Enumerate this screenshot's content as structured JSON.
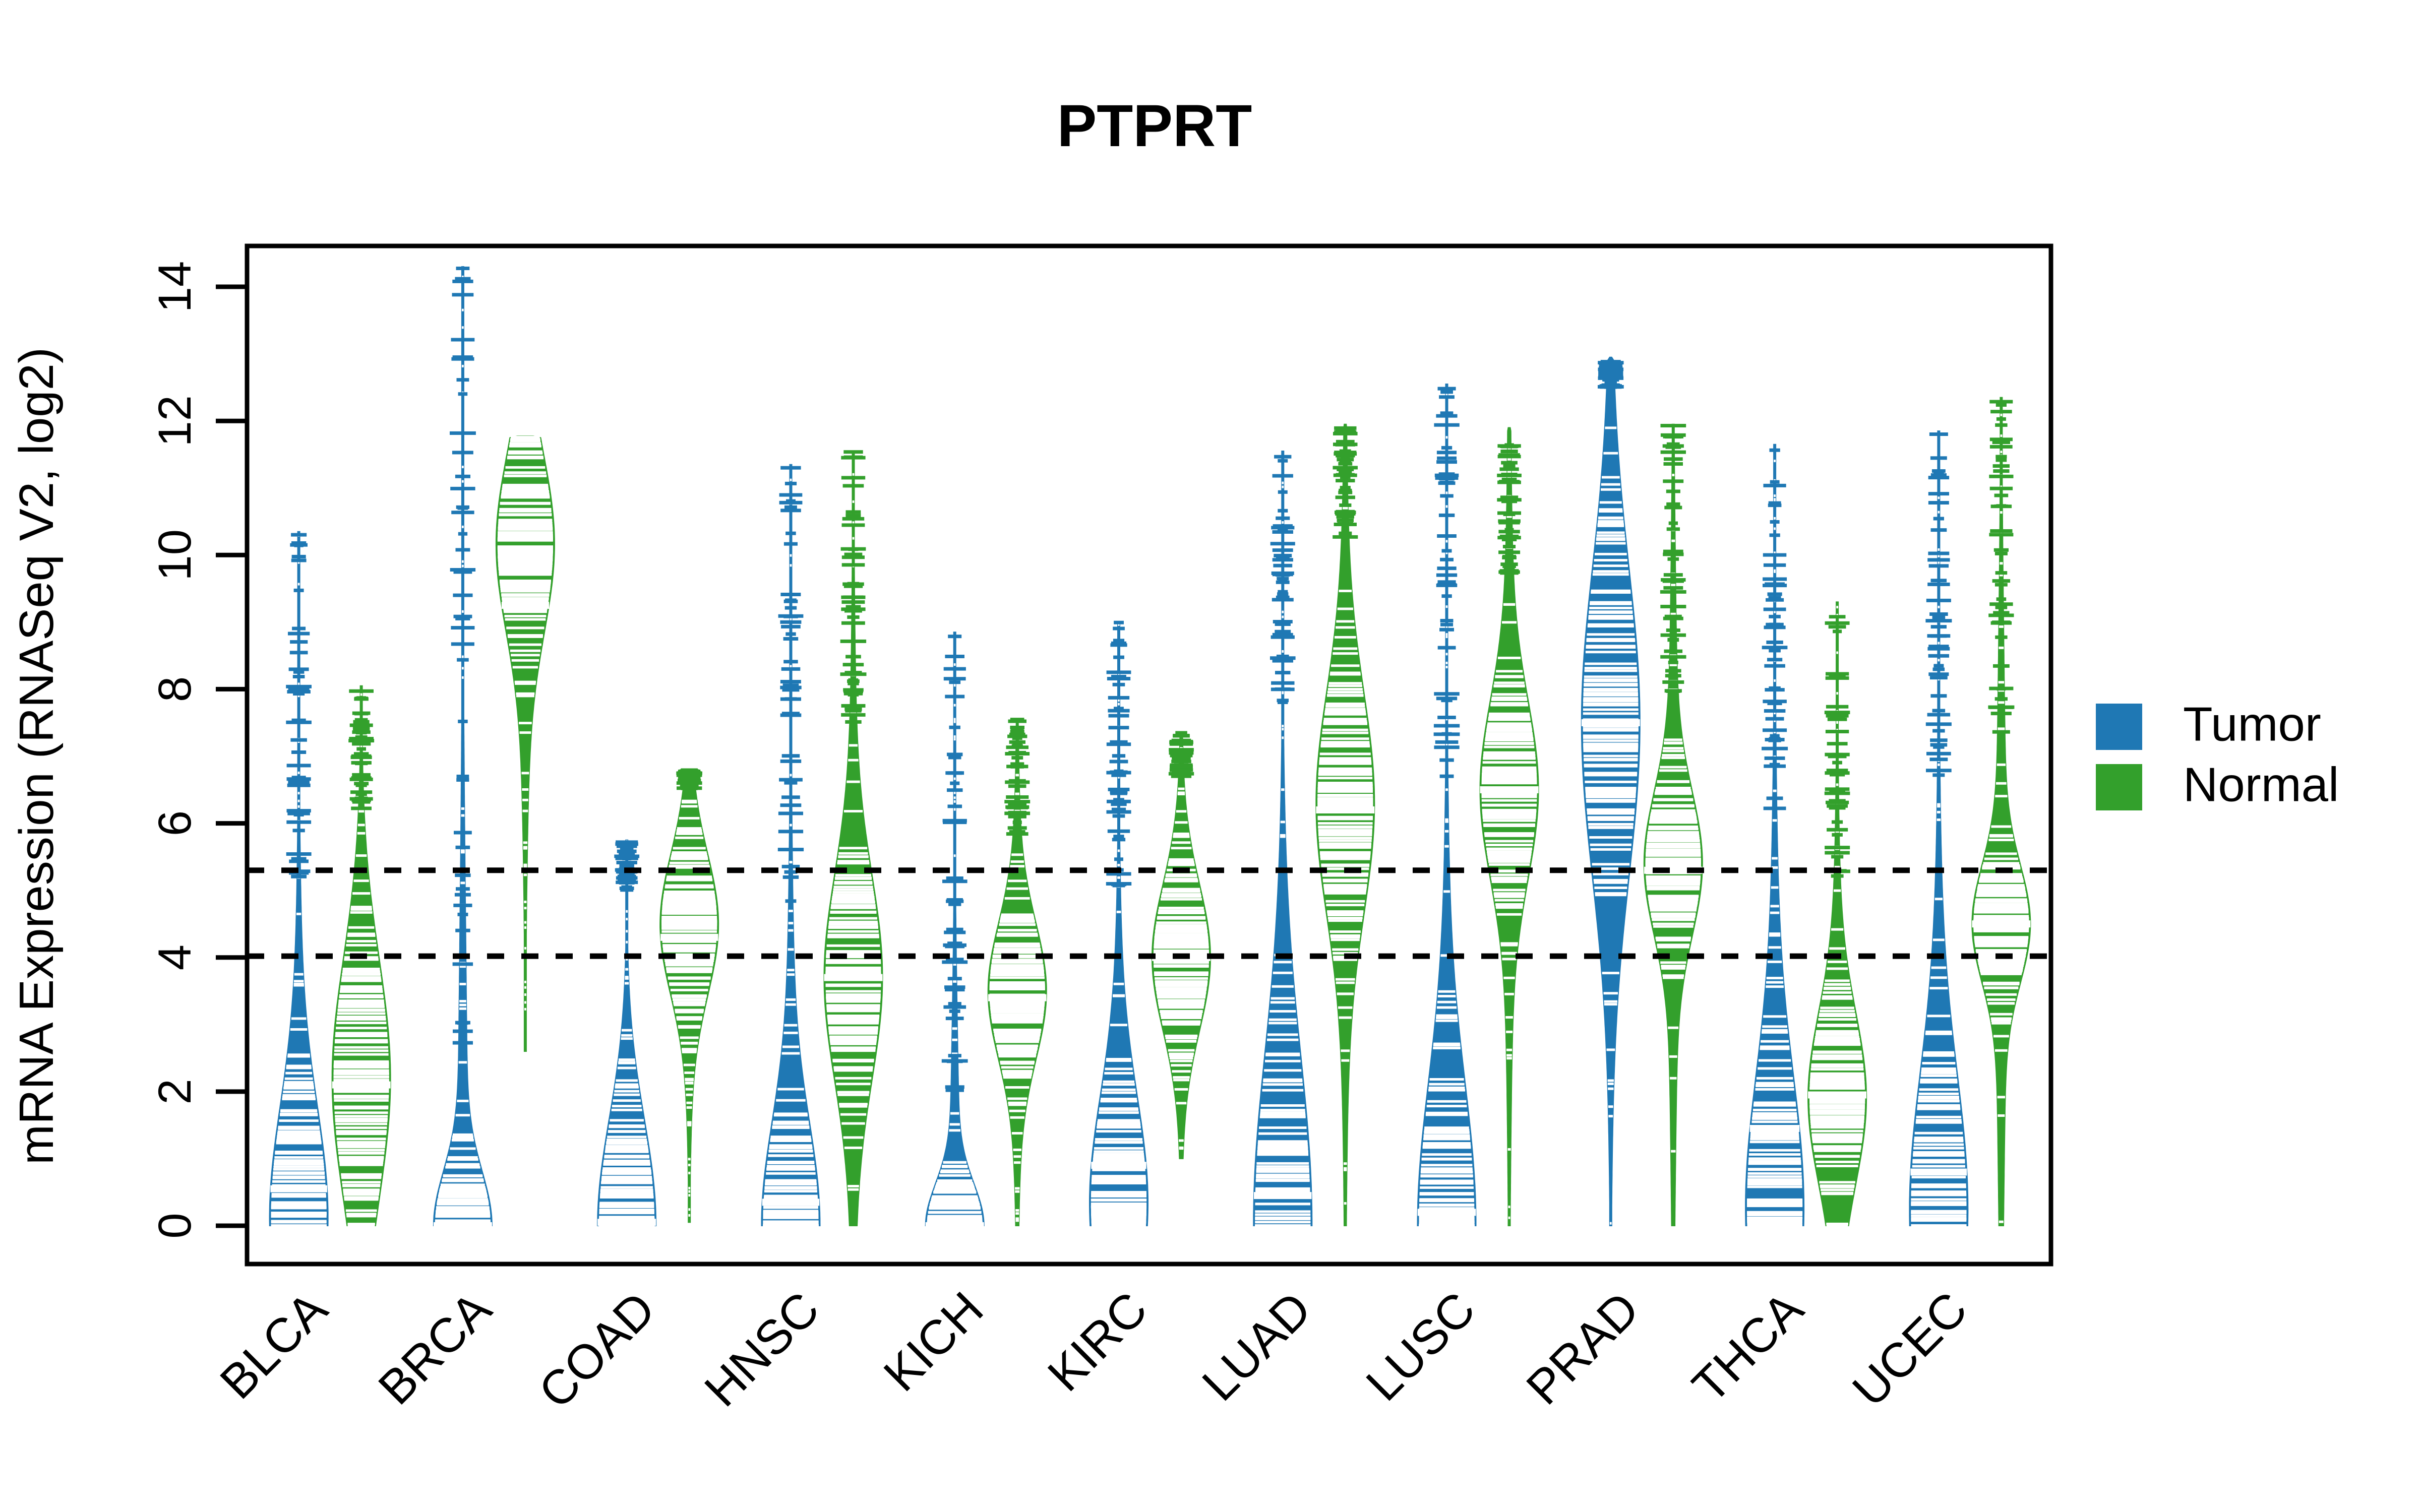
{
  "chart_data": {
    "type": "violin",
    "title": "PTPRT",
    "xlabel": "",
    "ylabel": "mRNA Expression (RNASeq V2, log2)",
    "ylim": [
      -0.6,
      14.6
    ],
    "yticks": [
      0,
      2,
      4,
      6,
      8,
      10,
      12,
      14
    ],
    "ytick_labels": [
      "0",
      "2",
      "4",
      "6",
      "8",
      "10",
      "12",
      "14"
    ],
    "grid": false,
    "legend_position": "right",
    "reference_lines": [
      5.3,
      4.02
    ],
    "categories": [
      "BLCA",
      "BRCA",
      "COAD",
      "HNSC",
      "KICH",
      "KIRC",
      "LUAD",
      "LUSC",
      "PRAD",
      "THCA",
      "UCEC"
    ],
    "legend": [
      {
        "name": "Tumor",
        "color": "#1f78b4"
      },
      {
        "name": "Normal",
        "color": "#33a02c"
      }
    ],
    "series": [
      {
        "name": "Tumor",
        "color": "#1f78b4",
        "groups": [
          {
            "category": "BLCA",
            "min": 0.0,
            "max": 10.35,
            "median": 0.55,
            "q1": 0.0,
            "q3": 2.6,
            "density_peak": 0.1,
            "n_label": ""
          },
          {
            "category": "BRCA",
            "min": 0.0,
            "max": 14.3,
            "median": 0.0,
            "q1": 0.0,
            "q3": 1.3,
            "density_peak": 0.0,
            "n_label": ""
          },
          {
            "category": "COAD",
            "min": 0.0,
            "max": 5.75,
            "median": 0.05,
            "q1": 0.0,
            "q3": 2.5,
            "density_peak": 0.0,
            "n_label": ""
          },
          {
            "category": "HNSC",
            "min": 0.0,
            "max": 11.35,
            "median": 0.35,
            "q1": 0.0,
            "q3": 2.4,
            "density_peak": 0.0,
            "n_label": ""
          },
          {
            "category": "KICH",
            "min": 0.0,
            "max": 8.85,
            "median": 0.0,
            "q1": 0.0,
            "q3": 1.0,
            "density_peak": 0.0,
            "n_label": ""
          },
          {
            "category": "KIRC",
            "min": 0.0,
            "max": 9.0,
            "median": 0.9,
            "q1": 0.0,
            "q3": 2.5,
            "density_peak": 0.3,
            "n_label": ""
          },
          {
            "category": "LUAD",
            "min": 0.0,
            "max": 11.55,
            "median": 0.45,
            "q1": 0.0,
            "q3": 3.9,
            "density_peak": 0.0,
            "n_label": ""
          },
          {
            "category": "LUSC",
            "min": 0.0,
            "max": 12.55,
            "median": 0.2,
            "q1": 0.0,
            "q3": 3.3,
            "density_peak": 0.0,
            "n_label": ""
          },
          {
            "category": "PRAD",
            "min": 0.0,
            "max": 12.95,
            "median": 7.5,
            "q1": 5.3,
            "q3": 8.9,
            "density_peak": 7.5,
            "n_label": ""
          },
          {
            "category": "THCA",
            "min": 0.0,
            "max": 11.65,
            "median": 1.45,
            "q1": 0.0,
            "q3": 3.1,
            "density_peak": 0.2,
            "n_label": ""
          },
          {
            "category": "UCEC",
            "min": 0.0,
            "max": 11.85,
            "median": 0.8,
            "q1": 0.0,
            "q3": 3.2,
            "density_peak": 0.2,
            "n_label": ""
          }
        ]
      },
      {
        "name": "Normal",
        "color": "#33a02c",
        "groups": [
          {
            "category": "BLCA",
            "min": 0.0,
            "max": 8.05,
            "median": 2.1,
            "q1": 0.6,
            "q3": 3.4,
            "density_peak": 2.2,
            "n_label": ""
          },
          {
            "category": "BRCA",
            "min": 2.6,
            "max": 11.8,
            "median": 9.25,
            "q1": 8.3,
            "q3": 10.4,
            "density_peak": 10.2,
            "n_label": ""
          },
          {
            "category": "COAD",
            "min": 0.05,
            "max": 6.8,
            "median": 4.3,
            "q1": 3.2,
            "q3": 4.85,
            "density_peak": 4.5,
            "n_label": ""
          },
          {
            "category": "HNSC",
            "min": 0.0,
            "max": 11.55,
            "median": 3.7,
            "q1": 2.7,
            "q3": 5.1,
            "density_peak": 3.7,
            "n_label": ""
          },
          {
            "category": "KICH",
            "min": 0.0,
            "max": 7.55,
            "median": 3.4,
            "q1": 2.6,
            "q3": 4.2,
            "density_peak": 3.5,
            "n_label": ""
          },
          {
            "category": "KIRC",
            "min": 1.0,
            "max": 7.35,
            "median": 4.0,
            "q1": 3.3,
            "q3": 5.0,
            "density_peak": 4.0,
            "n_label": ""
          },
          {
            "category": "LUAD",
            "min": 0.0,
            "max": 11.95,
            "median": 6.2,
            "q1": 5.0,
            "q3": 7.6,
            "density_peak": 6.3,
            "n_label": ""
          },
          {
            "category": "LUSC",
            "min": 0.0,
            "max": 11.9,
            "median": 6.5,
            "q1": 5.5,
            "q3": 7.6,
            "density_peak": 6.5,
            "n_label": ""
          },
          {
            "category": "PRAD",
            "min": 0.0,
            "max": 11.95,
            "median": 5.3,
            "q1": 4.5,
            "q3": 6.2,
            "density_peak": 5.4,
            "n_label": ""
          },
          {
            "category": "THCA",
            "min": 0.0,
            "max": 9.3,
            "median": 1.95,
            "q1": 1.2,
            "q3": 3.2,
            "density_peak": 1.9,
            "n_label": ""
          },
          {
            "category": "UCEC",
            "min": 0.0,
            "max": 12.35,
            "median": 4.5,
            "q1": 4.0,
            "q3": 5.4,
            "density_peak": 4.5,
            "n_label": ""
          }
        ]
      }
    ]
  },
  "axis": {
    "y_title": "mRNA Expression (RNASeq V2, log2)"
  },
  "title": {
    "text": "PTPRT"
  },
  "legend": {
    "tumor_label": "Tumor",
    "normal_label": "Normal"
  },
  "colors": {
    "tumor": "#1f78b4",
    "normal": "#33a02c",
    "axis": "#000000",
    "background": "#ffffff"
  }
}
